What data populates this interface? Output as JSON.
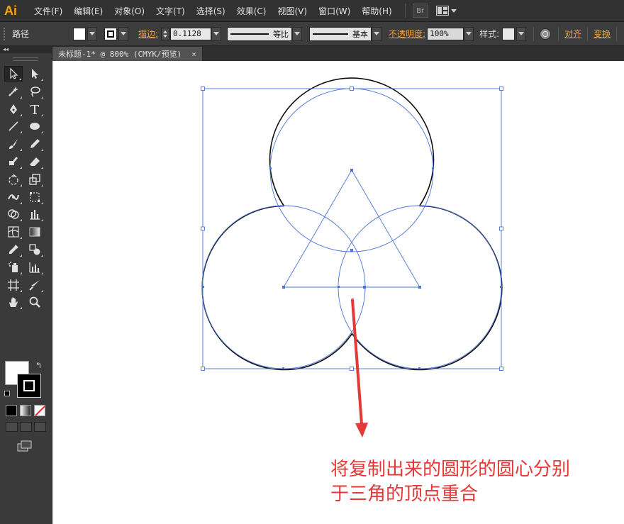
{
  "app": {
    "logo": "Ai"
  },
  "menu": {
    "items": [
      "文件(F)",
      "编辑(E)",
      "对象(O)",
      "文字(T)",
      "选择(S)",
      "效果(C)",
      "视图(V)",
      "窗口(W)",
      "帮助(H)"
    ],
    "bridge_label": "Br"
  },
  "control_bar": {
    "selection_type": "路径",
    "stroke_link": "描边:",
    "stroke_weight": "0.1128",
    "stroke_profile_1": "等比",
    "stroke_profile_2": "基本",
    "opacity_link": "不透明度:",
    "opacity_value": "100%",
    "style_label": "样式:",
    "align_link": "对齐",
    "transform_link": "变换",
    "fill_color": "#ffffff"
  },
  "tab": {
    "title": "未标题-1* @ 800% (CMYK/预览)",
    "close": "×"
  },
  "tools_panel": {
    "collapse": "◂◂"
  },
  "colors": {
    "accent_orange": "#f1a13a",
    "selection_blue": "#4a73d6",
    "annotation_red": "#e53838"
  },
  "canvas": {
    "annotation_line1": "将复制出来的圆形的圆心分别",
    "annotation_line2": "于三角的顶点重合"
  }
}
